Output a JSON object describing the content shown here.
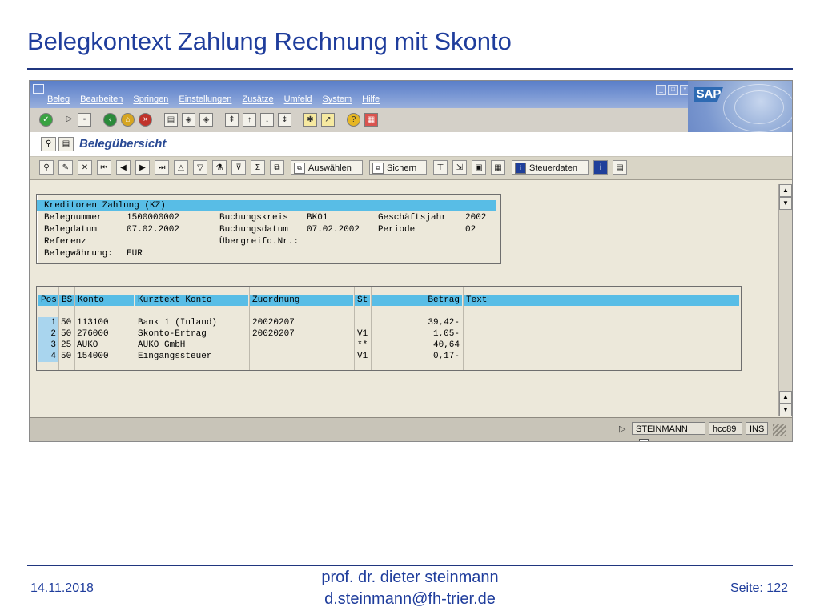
{
  "slide": {
    "title": "Belegkontext Zahlung Rechnung mit Skonto",
    "footer": {
      "date": "14.11.2018",
      "author_line1": "prof. dr. dieter steinmann",
      "author_line2": "d.steinmann@fh-trier.de",
      "page": "Seite: 122"
    }
  },
  "sap": {
    "logo": "SAP",
    "menu": [
      "Beleg",
      "Bearbeiten",
      "Springen",
      "Einstellungen",
      "Zusätze",
      "Umfeld",
      "System",
      "Hilfe"
    ],
    "screen_title": "Belegübersicht",
    "buttons": {
      "auswaehlen": "Auswählen",
      "sichern": "Sichern",
      "steuerdaten": "Steuerdaten"
    },
    "header": {
      "title": "Kreditoren Zahlung (KZ)",
      "belegnummer_label": "Belegnummer",
      "belegnummer": "1500000002",
      "buchungskreis_label": "Buchungskreis",
      "buchungskreis": "BK01",
      "geschaeftsjahr_label": "Geschäftsjahr",
      "geschaeftsjahr": "2002",
      "belegdatum_label": "Belegdatum",
      "belegdatum": "07.02.2002",
      "buchungsdatum_label": "Buchungsdatum",
      "buchungsdatum": "07.02.2002",
      "periode_label": "Periode",
      "periode": "02",
      "referenz_label": "Referenz",
      "uebergreifd_label": "Übergreifd.Nr.:",
      "waehrung_label": "Belegwährung:",
      "waehrung": "EUR"
    },
    "table": {
      "columns": [
        "Pos",
        "BS",
        "Konto",
        "Kurztext Konto",
        "Zuordnung",
        "St",
        "Betrag",
        "Text"
      ],
      "rows": [
        {
          "pos": "1",
          "bs": "50",
          "konto": "113100",
          "kurztext": "Bank 1 (Inland)",
          "zuordnung": "20020207",
          "st": "",
          "betrag": "39,42-",
          "text": ""
        },
        {
          "pos": "2",
          "bs": "50",
          "konto": "276000",
          "kurztext": "Skonto-Ertrag",
          "zuordnung": "20020207",
          "st": "V1",
          "betrag": "1,05-",
          "text": ""
        },
        {
          "pos": "3",
          "bs": "25",
          "konto": "AUKO",
          "kurztext": "AUKO GmbH",
          "zuordnung": "",
          "st": "**",
          "betrag": "40,64",
          "text": ""
        },
        {
          "pos": "4",
          "bs": "50",
          "konto": "154000",
          "kurztext": "Eingangssteuer",
          "zuordnung": "",
          "st": "V1",
          "betrag": "0,17-",
          "text": ""
        }
      ]
    },
    "status": {
      "user": "STEINMANN",
      "server": "hcc89",
      "mode": "INS"
    }
  }
}
